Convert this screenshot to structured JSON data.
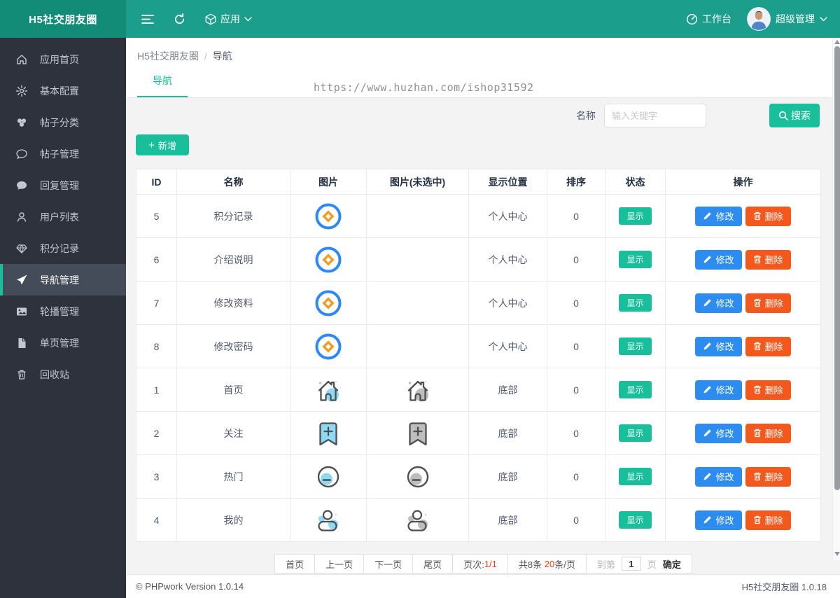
{
  "topbar": {
    "logo": "H5社交朋友圈",
    "app_menu": "应用",
    "workbench": "工作台",
    "user": "超级管理"
  },
  "sidebar": {
    "items": [
      {
        "key": "app-home",
        "icon": "home",
        "label": "应用首页",
        "active": false
      },
      {
        "key": "basic-config",
        "icon": "gear",
        "label": "基本配置",
        "active": false
      },
      {
        "key": "post-category",
        "icon": "category",
        "label": "帖子分类",
        "active": false
      },
      {
        "key": "post-manage",
        "icon": "chat-outline",
        "label": "帖子管理",
        "active": false
      },
      {
        "key": "reply-manage",
        "icon": "chat-filled",
        "label": "回复管理",
        "active": false
      },
      {
        "key": "user-list",
        "icon": "user",
        "label": "用户列表",
        "active": false
      },
      {
        "key": "points-record",
        "icon": "gem",
        "label": "积分记录",
        "active": false
      },
      {
        "key": "nav-manage",
        "icon": "send",
        "label": "导航管理",
        "active": true
      },
      {
        "key": "carousel-manage",
        "icon": "image",
        "label": "轮播管理",
        "active": false
      },
      {
        "key": "page-manage",
        "icon": "file",
        "label": "单页管理",
        "active": false
      },
      {
        "key": "recycle-bin",
        "icon": "trash",
        "label": "回收站",
        "active": false
      }
    ]
  },
  "breadcrumb": {
    "root": "H5社交朋友圈",
    "sep": "/",
    "current": "导航"
  },
  "tab": {
    "label": "导航"
  },
  "watermark": "https://www.huzhan.com/ishop31592",
  "search": {
    "label": "名称",
    "placeholder": "输入关键字",
    "button": "搜索"
  },
  "toolbar": {
    "add_plus": "+",
    "add_label": "新增"
  },
  "table": {
    "headers": [
      "ID",
      "名称",
      "图片",
      "图片(未选中)",
      "显示位置",
      "排序",
      "状态",
      "操作"
    ],
    "edit_label": "修改",
    "delete_label": "删除",
    "rows": [
      {
        "id": "5",
        "name": "积分记录",
        "icon": "coin",
        "unselected_icon": "",
        "position": "个人中心",
        "sort": "0",
        "status": "显示"
      },
      {
        "id": "6",
        "name": "介绍说明",
        "icon": "coin",
        "unselected_icon": "",
        "position": "个人中心",
        "sort": "0",
        "status": "显示"
      },
      {
        "id": "7",
        "name": "修改资料",
        "icon": "coin",
        "unselected_icon": "",
        "position": "个人中心",
        "sort": "0",
        "status": "显示"
      },
      {
        "id": "8",
        "name": "修改密码",
        "icon": "coin",
        "unselected_icon": "",
        "position": "个人中心",
        "sort": "0",
        "status": "显示"
      },
      {
        "id": "1",
        "name": "首页",
        "icon": "home-nav",
        "unselected_icon": "home-nav",
        "position": "底部",
        "sort": "0",
        "status": "显示"
      },
      {
        "id": "2",
        "name": "关注",
        "icon": "bookmark-plus",
        "unselected_icon": "bookmark-plus",
        "position": "底部",
        "sort": "0",
        "status": "显示"
      },
      {
        "id": "3",
        "name": "热门",
        "icon": "circle-minus",
        "unselected_icon": "circle-minus",
        "position": "底部",
        "sort": "0",
        "status": "显示"
      },
      {
        "id": "4",
        "name": "我的",
        "icon": "user-nav",
        "unselected_icon": "user-nav",
        "position": "底部",
        "sort": "0",
        "status": "显示"
      }
    ]
  },
  "pagination": {
    "first": "首页",
    "prev": "上一页",
    "next": "下一页",
    "last": "尾页",
    "page_info_prefix": "页次:",
    "page_info_value": "1/1",
    "total_prefix": "共8条 ",
    "total_highlight": "20",
    "total_suffix": "条/页",
    "goto_prefix": "到第",
    "goto_value": "1",
    "goto_suffix": "页",
    "confirm": "确定"
  },
  "footer": {
    "left": "© PHPwork Version 1.0.14",
    "right": "H5社交朋友圈 1.0.18"
  },
  "colors": {
    "accent": "#19be9b",
    "edit": "#2d8cf0",
    "delete": "#f4581c",
    "red": "#ed3f14",
    "icon_blue": "#8fd9f5",
    "icon_gray": "#bdbdbd",
    "icon_outline": "#4f4f4f",
    "coin_ring": "#2f88f7",
    "coin_diamond": "#f29c1f"
  }
}
